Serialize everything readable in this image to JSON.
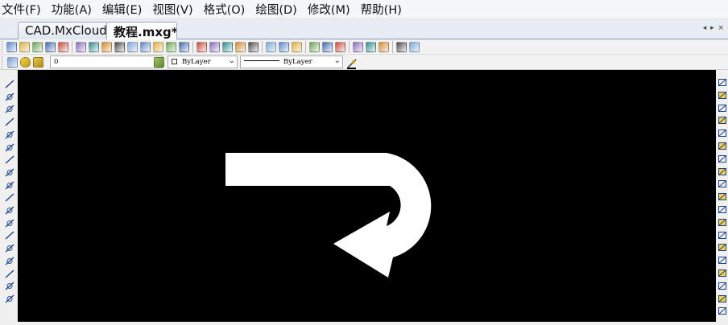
{
  "menu": [
    "文件(F)",
    "功能(A)",
    "编辑(E)",
    "视图(V)",
    "格式(O)",
    "绘图(D)",
    "修改(M)",
    "帮助(H)"
  ],
  "tabs": [
    {
      "label": "CAD.MxCloud",
      "active": false
    },
    {
      "label": "教程.mxg*",
      "active": true
    }
  ],
  "tab_nav": "◂ ▸ ×",
  "layer_combo": {
    "value": "0"
  },
  "color_combo": {
    "value": "ByLayer"
  },
  "linetype_combo": {
    "value": "ByLayer"
  },
  "icons": {
    "main_toolbar": [
      "new-file-icon",
      "open-folder-icon",
      "open-cloud-icon",
      "save-icon",
      "save-as-icon",
      "zoom-window-icon",
      "zoom-realtime-icon",
      "zoom-in-icon",
      "pan-icon",
      "zoom-extents-icon",
      "zoom-previous-icon",
      "measure-icon",
      "zoom-scale-icon",
      "zoom-all-icon",
      "zoom-out-icon",
      "pan-hand-icon",
      "pencil-icon",
      "properties-icon",
      "layers-icon",
      "dimension-icon",
      "grid-icon",
      "match-icon",
      "print-icon",
      "undo-icon",
      "redo-icon",
      "color-picker-icon",
      "settings-icon",
      "help-icon",
      "pdf-icon",
      "image-export-icon"
    ],
    "left_toolbar": [
      "line-icon",
      "construction-line-icon",
      "polyline-icon",
      "polygon-icon",
      "rectangle-icon",
      "rectangle2-icon",
      "arc-icon",
      "circle-icon",
      "spline-icon",
      "ellipse-icon",
      "ellipse-arc-icon",
      "point-icon",
      "insert-block-icon",
      "make-block-icon",
      "text-icon",
      "table-icon",
      "multiline-text-icon",
      "hatch-icon"
    ],
    "right_toolbar": [
      "erase-icon",
      "copy-icon",
      "mirror-icon",
      "move-icon",
      "rotate-icon",
      "scale-icon",
      "array-icon",
      "offset-icon",
      "fillet-icon",
      "chamfer-icon",
      "trim-icon",
      "extend-icon",
      "break-icon",
      "stretch-icon",
      "lengthen-icon",
      "explode-icon",
      "join-icon",
      "dimension-icon",
      "angular-dim-icon"
    ]
  },
  "colors": {
    "canvas": "#000000",
    "drawing": "#ffffff"
  }
}
